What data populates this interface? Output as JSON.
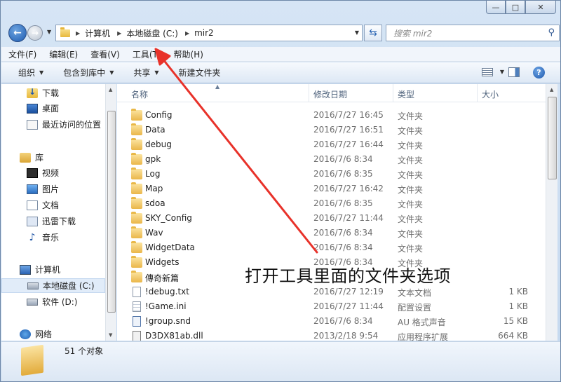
{
  "window": {
    "minimize_glyph": "—",
    "maximize_glyph": "□",
    "close_glyph": "✕"
  },
  "address_bar": {
    "segments": [
      "计算机",
      "本地磁盘 (C:)",
      "mir2"
    ]
  },
  "search": {
    "placeholder": "搜索 mir2"
  },
  "menu": {
    "items": [
      "文件(F)",
      "编辑(E)",
      "查看(V)",
      "工具(T)",
      "帮助(H)"
    ]
  },
  "toolbar": {
    "organize": "组织",
    "include_in_library": "包含到库中",
    "share": "共享",
    "new_folder": "新建文件夹"
  },
  "nav_pane": {
    "items": [
      {
        "label": "下载",
        "icon": "downloads-icon"
      },
      {
        "label": "桌面",
        "icon": "desktop-icon"
      },
      {
        "label": "最近访问的位置",
        "icon": "recent-places-icon"
      },
      {
        "label": "库",
        "icon": "libraries-icon"
      },
      {
        "label": "视频",
        "icon": "videos-icon"
      },
      {
        "label": "图片",
        "icon": "pictures-icon"
      },
      {
        "label": "文档",
        "icon": "documents-icon"
      },
      {
        "label": "迅雷下载",
        "icon": "thunder-download-icon"
      },
      {
        "label": "音乐",
        "icon": "music-icon"
      },
      {
        "label": "计算机",
        "icon": "computer-icon"
      },
      {
        "label": "本地磁盘 (C:)",
        "icon": "drive-c-icon"
      },
      {
        "label": "软件 (D:)",
        "icon": "drive-d-icon"
      },
      {
        "label": "网络",
        "icon": "network-icon"
      }
    ]
  },
  "columns": {
    "name": "名称",
    "modified": "修改日期",
    "type": "类型",
    "size": "大小"
  },
  "files": [
    {
      "name": "Config",
      "date": "2016/7/27 16:45",
      "type": "文件夹",
      "size": "",
      "kind": "folder"
    },
    {
      "name": "Data",
      "date": "2016/7/27 16:51",
      "type": "文件夹",
      "size": "",
      "kind": "folder"
    },
    {
      "name": "debug",
      "date": "2016/7/27 16:44",
      "type": "文件夹",
      "size": "",
      "kind": "folder"
    },
    {
      "name": "gpk",
      "date": "2016/7/6 8:34",
      "type": "文件夹",
      "size": "",
      "kind": "folder"
    },
    {
      "name": "Log",
      "date": "2016/7/6 8:35",
      "type": "文件夹",
      "size": "",
      "kind": "folder"
    },
    {
      "name": "Map",
      "date": "2016/7/27 16:42",
      "type": "文件夹",
      "size": "",
      "kind": "folder"
    },
    {
      "name": "sdoa",
      "date": "2016/7/6 8:35",
      "type": "文件夹",
      "size": "",
      "kind": "folder"
    },
    {
      "name": "SKY_Config",
      "date": "2016/7/27 11:44",
      "type": "文件夹",
      "size": "",
      "kind": "folder"
    },
    {
      "name": "Wav",
      "date": "2016/7/6 8:34",
      "type": "文件夹",
      "size": "",
      "kind": "folder"
    },
    {
      "name": "WidgetData",
      "date": "2016/7/6 8:34",
      "type": "文件夹",
      "size": "",
      "kind": "folder"
    },
    {
      "name": "Widgets",
      "date": "2016/7/6 8:34",
      "type": "文件夹",
      "size": "",
      "kind": "folder"
    },
    {
      "name": "傳奇新篇",
      "date": "",
      "type": "",
      "size": "",
      "kind": "folder"
    },
    {
      "name": "!debug.txt",
      "date": "2016/7/27 12:19",
      "type": "文本文档",
      "size": "1 KB",
      "kind": "txt"
    },
    {
      "name": "!Game.ini",
      "date": "2016/7/27 11:44",
      "type": "配置设置",
      "size": "1 KB",
      "kind": "ini"
    },
    {
      "name": "!group.snd",
      "date": "2016/7/6 8:34",
      "type": "AU 格式声音",
      "size": "15 KB",
      "kind": "snd"
    },
    {
      "name": "D3DX81ab.dll",
      "date": "2013/2/18 9:54",
      "type": "应用程序扩展",
      "size": "664 KB",
      "kind": "dll"
    }
  ],
  "status": {
    "count": "51 个对象"
  },
  "annotation": {
    "text": "打开工具里面的文件夹选项",
    "color": "#e8322a"
  }
}
